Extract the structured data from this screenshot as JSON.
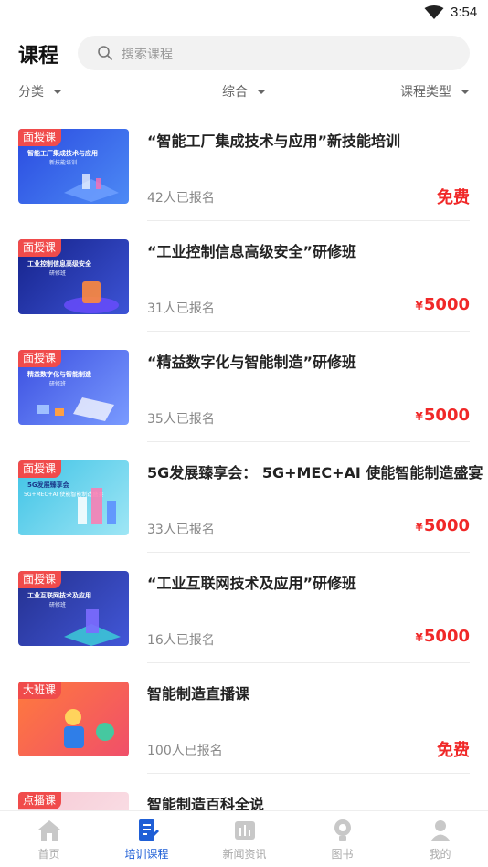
{
  "status_bar": {
    "time": "3:54"
  },
  "header": {
    "title": "课程",
    "search_placeholder": "搜索课程"
  },
  "filters": [
    "分类",
    "综合",
    "课程类型"
  ],
  "courses": [
    {
      "tag": "面授课",
      "title": "“智能工厂集成技术与应用”新技能培训",
      "enrolled": "42人已报名",
      "price": "免费",
      "is_free": true,
      "thumb_title": "智能工厂集成技术与应用",
      "thumb_sub": "新技能培训",
      "thumb_color": "#2a4be0"
    },
    {
      "tag": "面授课",
      "title": "“工业控制信息高级安全”研修班",
      "enrolled": "31人已报名",
      "price": "5000",
      "is_free": false,
      "thumb_title": "工业控制信息高级安全",
      "thumb_sub": "研修班",
      "thumb_color": "#1c2f9e"
    },
    {
      "tag": "面授课",
      "title": "“精益数字化与智能制造”研修班",
      "enrolled": "35人已报名",
      "price": "5000",
      "is_free": false,
      "thumb_title": "精益数字化与智能制造",
      "thumb_sub": "研修班",
      "thumb_color": "#3b4fe0"
    },
    {
      "tag": "面授课",
      "title": "5G发展臻享会： 5G+MEC+AI 使能智能制造盛宴",
      "enrolled": "33人已报名",
      "price": "5000",
      "is_free": false,
      "thumb_title": "5G发展臻享会",
      "thumb_sub": "5G+MEC+AI 使能智能制造盛宴",
      "thumb_color": "#3fc3e6"
    },
    {
      "tag": "面授课",
      "title": "“工业互联网技术及应用”研修班",
      "enrolled": "16人已报名",
      "price": "5000",
      "is_free": false,
      "thumb_title": "工业互联网技术及应用",
      "thumb_sub": "研修班",
      "thumb_color": "#2b3aa8"
    },
    {
      "tag": "大班课",
      "title": "智能制造直播课",
      "enrolled": "100人已报名",
      "price": "免费",
      "is_free": true,
      "thumb_title": "",
      "thumb_sub": "",
      "thumb_color": "#f0643c"
    },
    {
      "tag": "点播课",
      "title": "智能制造百科全说",
      "enrolled": "",
      "price": "",
      "is_free": false,
      "thumb_title": "",
      "thumb_sub": "",
      "thumb_color": "#f6c9d4"
    }
  ],
  "currency_symbol": "¥",
  "bottom_nav": [
    {
      "label": "首页",
      "icon": "home-icon",
      "active": false
    },
    {
      "label": "培训课程",
      "icon": "course-icon",
      "active": true
    },
    {
      "label": "新闻资讯",
      "icon": "news-icon",
      "active": false
    },
    {
      "label": "图书",
      "icon": "book-icon",
      "active": false
    },
    {
      "label": "我的",
      "icon": "profile-icon",
      "active": false
    }
  ],
  "colors": {
    "accent": "#1f5fd6",
    "price": "#f02828",
    "tag": "#f04b4b"
  }
}
